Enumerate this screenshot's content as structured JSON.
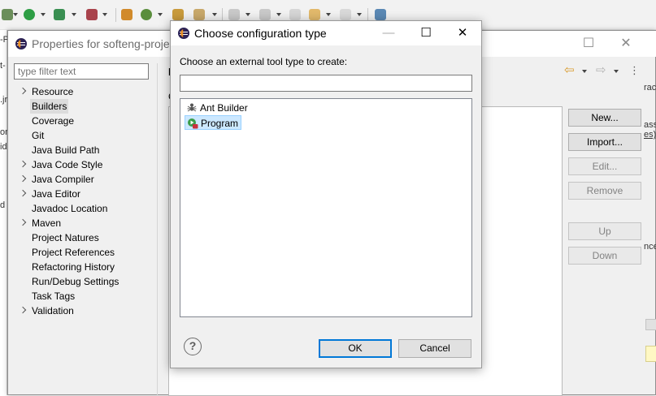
{
  "background": {
    "left_fragments": [
      "-Pl",
      "t-",
      ".jr",
      "ora",
      "ide",
      "d"
    ],
    "right_fragments": [
      "rac",
      "ass",
      "es)",
      "nce"
    ]
  },
  "properties_window": {
    "title": "Properties for softeng-projec",
    "filter_placeholder": "type filter text",
    "tree_items": [
      {
        "label": "Resource",
        "expandable": true
      },
      {
        "label": "Builders",
        "expandable": false,
        "selected": true
      },
      {
        "label": "Coverage",
        "expandable": false
      },
      {
        "label": "Git",
        "expandable": false
      },
      {
        "label": "Java Build Path",
        "expandable": false
      },
      {
        "label": "Java Code Style",
        "expandable": true
      },
      {
        "label": "Java Compiler",
        "expandable": true
      },
      {
        "label": "Java Editor",
        "expandable": true
      },
      {
        "label": "Javadoc Location",
        "expandable": false
      },
      {
        "label": "Maven",
        "expandable": true
      },
      {
        "label": "Project Natures",
        "expandable": false
      },
      {
        "label": "Project References",
        "expandable": false
      },
      {
        "label": "Refactoring History",
        "expandable": false
      },
      {
        "label": "Run/Debug Settings",
        "expandable": false
      },
      {
        "label": "Task Tags",
        "expandable": false
      },
      {
        "label": "Validation",
        "expandable": true
      }
    ],
    "panel_fragment": "E",
    "panel_fragment_2": "C",
    "side_buttons": [
      {
        "label": "New...",
        "enabled": true
      },
      {
        "label": "Import...",
        "enabled": true
      },
      {
        "label": "Edit...",
        "enabled": false
      },
      {
        "label": "Remove",
        "enabled": false
      },
      {
        "label": "Up",
        "enabled": false
      },
      {
        "label": "Down",
        "enabled": false
      }
    ]
  },
  "dialog": {
    "title": "Choose configuration type",
    "prompt": "Choose an external tool type to create:",
    "filter_value": "",
    "types": [
      {
        "label": "Ant Builder",
        "icon": "ant-icon",
        "selected": false
      },
      {
        "label": "Program",
        "icon": "program-launch-icon",
        "selected": true
      }
    ],
    "ok_label": "OK",
    "cancel_label": "Cancel",
    "help_glyph": "?",
    "minimize_glyph": "—",
    "maximize_glyph": "☐",
    "close_glyph": "✕"
  },
  "colors": {
    "selection": "#cce8ff",
    "default_button_border": "#0078d7",
    "eclipse_orange": "#f7941e",
    "eclipse_purple": "#2c2255"
  }
}
